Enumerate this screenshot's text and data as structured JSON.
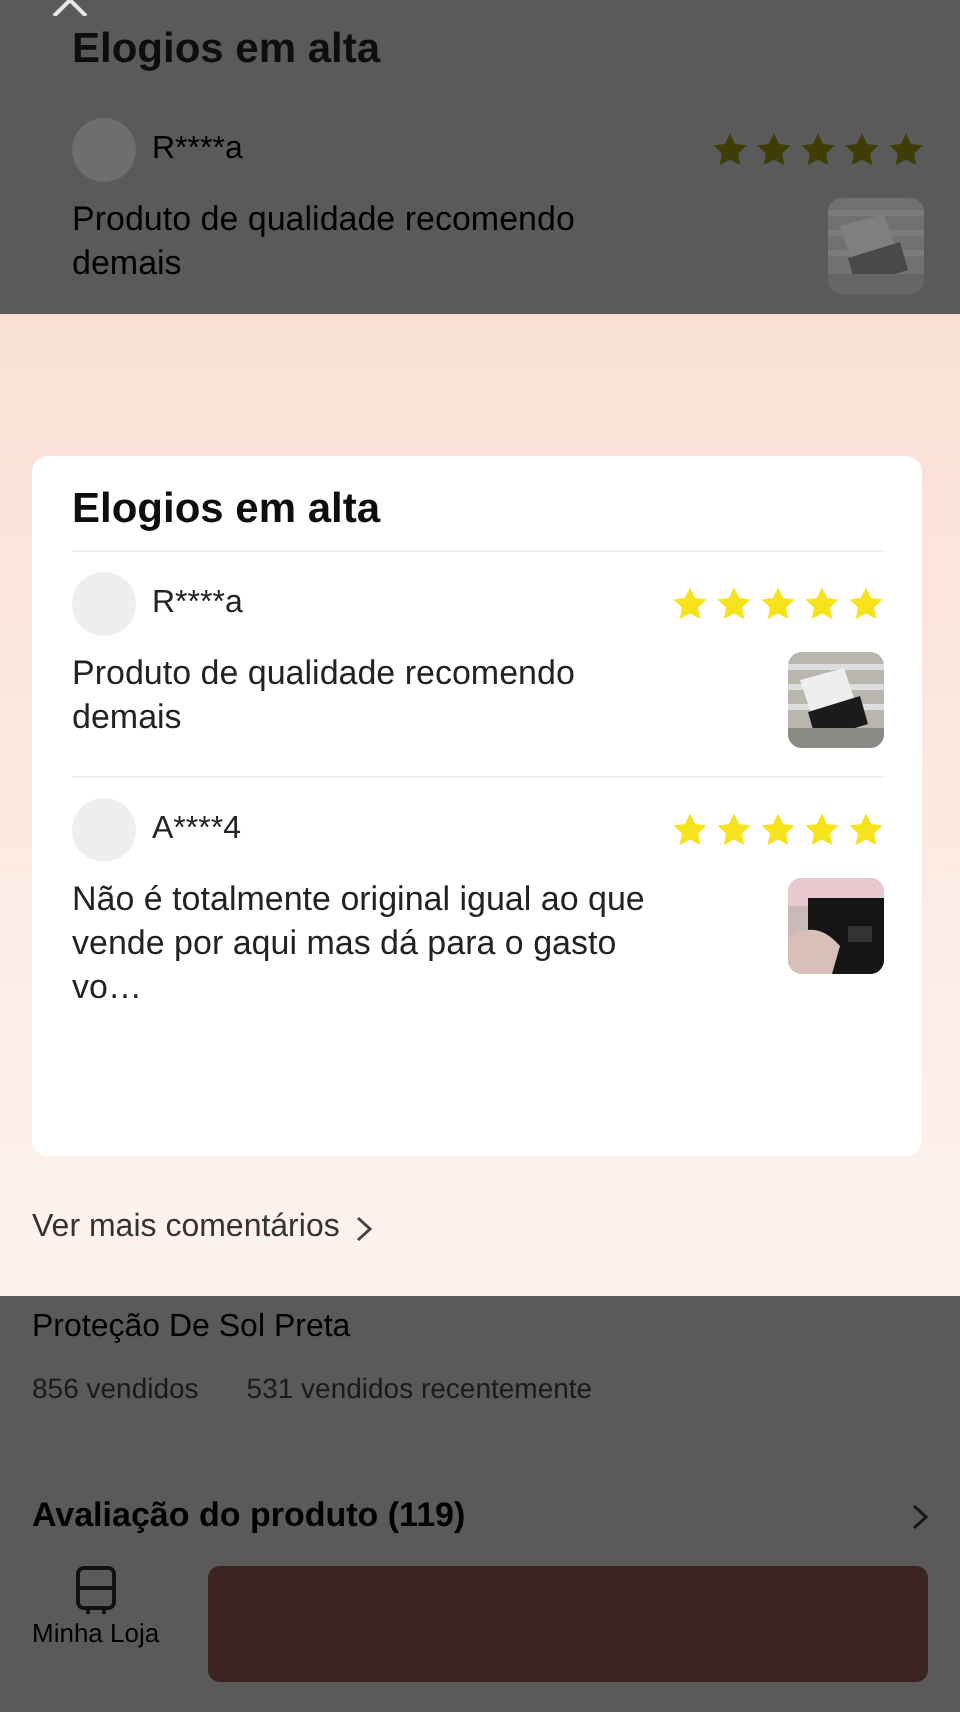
{
  "background_highlights": {
    "title": "Elogios em alta",
    "reviews": [
      {
        "user": "R****a",
        "stars": 5,
        "text": "Produto de qualidade recomendo demais"
      }
    ]
  },
  "highlight_card": {
    "title": "Elogios em alta",
    "reviews": [
      {
        "user": "R****a",
        "stars": 5,
        "text": "Produto de qualidade recomendo demais"
      },
      {
        "user": "A****4",
        "stars": 5,
        "text": "Não é totalmente original igual ao que vende por aqui mas dá para o gasto vo…"
      }
    ],
    "more_link": "Ver mais comentários"
  },
  "product": {
    "name": "Proteção De Sol Preta",
    "sold": "856 vendidos",
    "recent_sales": "531 vendidos recentemente"
  },
  "rating_section": {
    "title": "Avaliação do produto (119)"
  },
  "bottom_bar": {
    "store_label": "Minha Loja"
  }
}
